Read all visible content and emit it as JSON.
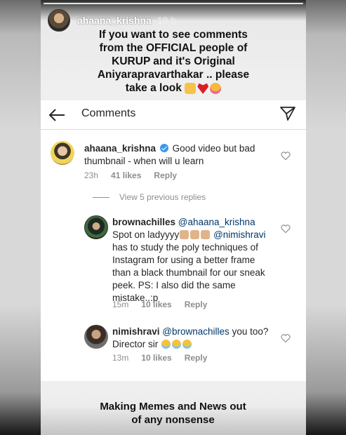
{
  "story": {
    "username": "ahaana_krishna",
    "time": "19 h",
    "caption_lines": [
      "If you want to see comments",
      "from the OFFICIAL people of",
      "KURUP and it's Original",
      "Aniyarapravarthakar .. please",
      "take a look"
    ],
    "caption_emojis": [
      "raising-hands-icon",
      "red-heart-icon",
      "smiling-face-with-hearts-icon"
    ],
    "footer_lines": [
      "Making Memes and News out",
      "of any nonsense"
    ]
  },
  "comments_screen": {
    "title": "Comments",
    "view_replies": "View 5 previous replies",
    "comments": [
      {
        "username": "ahaana_krishna",
        "verified": true,
        "text": "Good video but bad thumbnail - when will u learn",
        "age": "23h",
        "likes": "41 likes",
        "reply": "Reply"
      },
      {
        "username": "brownachilles",
        "mention_1": "@ahaana_krishna",
        "text_a": "Spot on ladyyyy",
        "mention_2": "@nimishravi",
        "text_b": "has to study the poly techniques of Instagram for using a better frame than a black thumbnail for our sneak peek. PS: I also did the same mistake..:p",
        "age": "15m",
        "likes": "10 likes",
        "reply": "Reply"
      },
      {
        "username": "nimishravi",
        "mention": "@brownachilles",
        "text_a": "you too?",
        "text_b": "Director sir",
        "age": "13m",
        "likes": "10 likes",
        "reply": "Reply"
      }
    ]
  },
  "colors": {
    "mention": "#00376b",
    "meta": "#8e8e8e",
    "verified": "#3897f0"
  }
}
